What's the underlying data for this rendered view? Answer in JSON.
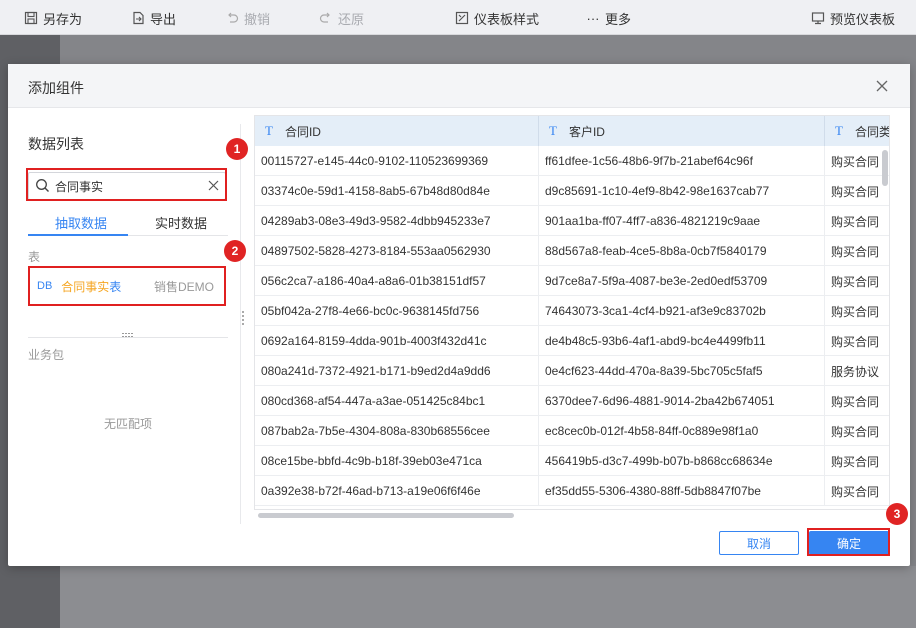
{
  "toolbar": {
    "items": [
      {
        "label": "另存为",
        "icon": "save-icon"
      },
      {
        "label": "导出",
        "icon": "export-icon"
      },
      {
        "label": "撤销",
        "icon": "undo-icon"
      },
      {
        "label": "还原",
        "icon": "redo-icon"
      },
      {
        "label": "仪表板样式",
        "icon": "style-icon"
      },
      {
        "label": "更多",
        "icon": "more-icon"
      },
      {
        "label": "预览仪表板",
        "icon": "preview-icon"
      }
    ]
  },
  "dialog": {
    "title": "添加组件",
    "left": {
      "list_title": "数据列表",
      "search_value": "合同事实",
      "tabs": [
        "抽取数据",
        "实时数据"
      ],
      "section_label": "表",
      "table_item": {
        "tag": "DB",
        "name_highlight": "合同事实",
        "name_rest": "表",
        "package": "销售DEMO"
      },
      "biz_label": "业务包",
      "no_match": "无匹配项"
    },
    "grid": {
      "columns": [
        "合同ID",
        "客户ID",
        "合同类型"
      ],
      "rows": [
        [
          "00115727-e145-44c0-9102-110523699369",
          "ff61dfee-1c56-48b6-9f7b-21abef64c96f",
          "购买合同"
        ],
        [
          "03374c0e-59d1-4158-8ab5-67b48d80d84e",
          "d9c85691-1c10-4ef9-8b42-98e1637cab77",
          "购买合同"
        ],
        [
          "04289ab3-08e3-49d3-9582-4dbb945233e7",
          "901aa1ba-ff07-4ff7-a836-4821219c9aae",
          "购买合同"
        ],
        [
          "04897502-5828-4273-8184-553aa0562930",
          "88d567a8-feab-4ce5-8b8a-0cb7f5840179",
          "购买合同"
        ],
        [
          "056c2ca7-a186-40a4-a8a6-01b38151df57",
          "9d7ce8a7-5f9a-4087-be3e-2ed0edf53709",
          "购买合同"
        ],
        [
          "05bf042a-27f8-4e66-bc0c-9638145fd756",
          "74643073-3ca1-4cf4-b921-af3e9c83702b",
          "购买合同"
        ],
        [
          "0692a164-8159-4dda-901b-4003f432d41c",
          "de4b48c5-93b6-4af1-abd9-bc4e4499fb11",
          "购买合同"
        ],
        [
          "080a241d-7372-4921-b171-b9ed2d4a9dd6",
          "0e4cf623-44dd-470a-8a39-5bc705c5faf5",
          "服务协议"
        ],
        [
          "080cd368-af54-447a-a3ae-051425c84bc1",
          "6370dee7-6d96-4881-9014-2ba42b674051",
          "购买合同"
        ],
        [
          "087bab2a-7b5e-4304-808a-830b68556cee",
          "ec8cec0b-012f-4b58-84ff-0c889e98f1a0",
          "购买合同"
        ],
        [
          "08ce15be-bbfd-4c9b-b18f-39eb03e471ca",
          "456419b5-d3c7-499b-b07b-b868cc68634e",
          "购买合同"
        ],
        [
          "0a392e38-b72f-46ad-b713-a19e06f6f46e",
          "ef35dd55-5306-4380-88ff-5db8847f07be",
          "购买合同"
        ]
      ]
    },
    "buttons": {
      "cancel": "取消",
      "ok": "确定"
    }
  },
  "annotations": [
    "1",
    "2",
    "3"
  ],
  "colors": {
    "accent": "#3685f2",
    "highlight": "#f5a623",
    "annotation": "#e02020"
  }
}
